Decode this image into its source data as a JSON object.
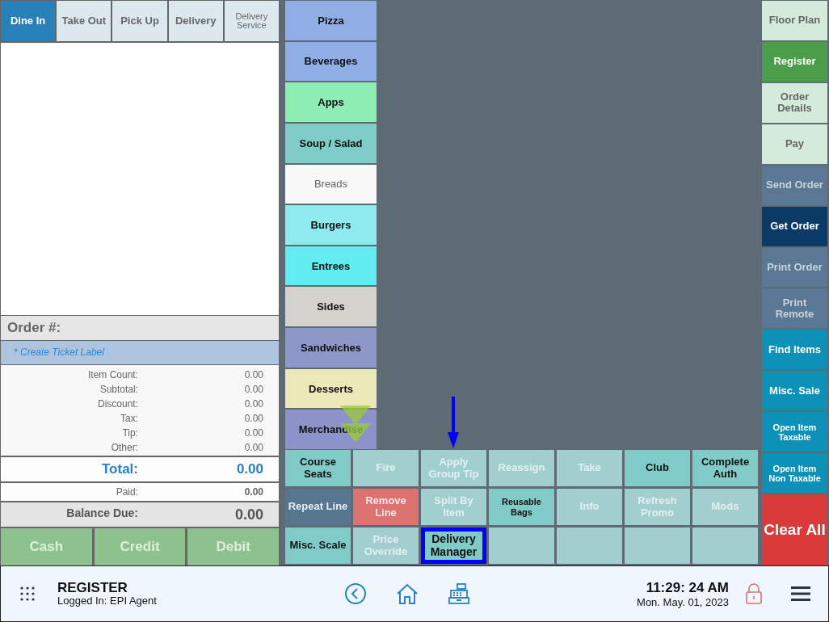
{
  "order_types": [
    {
      "label": "Dine In",
      "selected": true
    },
    {
      "label": "Take Out",
      "selected": false
    },
    {
      "label": "Pick Up",
      "selected": false
    },
    {
      "label": "Delivery",
      "selected": false
    },
    {
      "label": "Delivery Service",
      "selected": false
    }
  ],
  "order": {
    "title": "Order #:",
    "ticket_label": "* Create Ticket Label",
    "summary": [
      {
        "label": "Item Count:",
        "value": "0.00"
      },
      {
        "label": "Subtotal:",
        "value": "0.00"
      },
      {
        "label": "Discount:",
        "value": "0.00"
      },
      {
        "label": "Tax:",
        "value": "0.00"
      },
      {
        "label": "Tip:",
        "value": "0.00"
      },
      {
        "label": "Other:",
        "value": "0.00"
      }
    ],
    "total": {
      "label": "Total:",
      "value": "0.00"
    },
    "paid": {
      "label": "Paid:",
      "value": "0.00"
    },
    "balance_due": {
      "label": "Balance Due:",
      "value": "0.00"
    }
  },
  "payment_buttons": [
    {
      "label": "Cash",
      "disabled": true
    },
    {
      "label": "Credit",
      "disabled": true
    },
    {
      "label": "Debit",
      "disabled": true
    }
  ],
  "categories": [
    {
      "label": "Pizza",
      "color": "#8faee6"
    },
    {
      "label": "Beverages",
      "color": "#8faee6"
    },
    {
      "label": "Apps",
      "color": "#8eedb2"
    },
    {
      "label": "Soup / Salad",
      "color": "#7fcdc9"
    },
    {
      "label": "Breads",
      "color": "#f8f8f8"
    },
    {
      "label": "Burgers",
      "color": "#8debf0"
    },
    {
      "label": "Entrees",
      "color": "#60ecf0"
    },
    {
      "label": "Sides",
      "color": "#d4d2cc"
    },
    {
      "label": "Sandwiches",
      "color": "#8d97c8"
    },
    {
      "label": "Desserts",
      "color": "#ede8b8"
    },
    {
      "label": "Merchandise",
      "color": "#8d93c8"
    }
  ],
  "actions": [
    {
      "label": "Course Seats",
      "kind": "enabled",
      "highlighted": false
    },
    {
      "label": "Fire",
      "kind": "disabled",
      "highlighted": false
    },
    {
      "label": "Apply Group Tip",
      "kind": "disabled",
      "highlighted": false
    },
    {
      "label": "Reassign",
      "kind": "disabled",
      "highlighted": false
    },
    {
      "label": "Take",
      "kind": "disabled",
      "highlighted": false
    },
    {
      "label": "Club",
      "kind": "enabled",
      "highlighted": false
    },
    {
      "label": "Complete Auth",
      "kind": "enabled",
      "highlighted": false
    },
    {
      "label": "Repeat Line",
      "kind": "dark",
      "highlighted": false
    },
    {
      "label": "Remove Line",
      "kind": "danger",
      "highlighted": false
    },
    {
      "label": "Split By Item",
      "kind": "disabled",
      "highlighted": false
    },
    {
      "label": "Reusable Bags",
      "kind": "small",
      "highlighted": false
    },
    {
      "label": "Info",
      "kind": "disabled",
      "highlighted": false
    },
    {
      "label": "Refresh Promo",
      "kind": "disabled",
      "highlighted": false
    },
    {
      "label": "Mods",
      "kind": "disabled",
      "highlighted": false
    },
    {
      "label": "Misc. Scale",
      "kind": "enabled",
      "highlighted": false
    },
    {
      "label": "Price Override",
      "kind": "disabled",
      "highlighted": false
    },
    {
      "label": "Delivery Manager",
      "kind": "enabled",
      "highlighted": true
    },
    {
      "kind": "empty",
      "highlighted": false
    },
    {
      "kind": "empty",
      "highlighted": false
    },
    {
      "kind": "empty",
      "highlighted": false
    },
    {
      "kind": "empty",
      "highlighted": false
    }
  ],
  "side_buttons": [
    {
      "label": "Floor Plan",
      "kind": "light"
    },
    {
      "label": "Register",
      "kind": "active"
    },
    {
      "label": "Order Details",
      "kind": "light"
    },
    {
      "label": "Pay",
      "kind": "light"
    },
    {
      "label": "Send Order",
      "kind": "slate"
    },
    {
      "label": "Get Order",
      "kind": "navy"
    },
    {
      "label": "Print Order",
      "kind": "slate"
    },
    {
      "label": "Print Remote",
      "kind": "slate"
    },
    {
      "label": "Find Items",
      "kind": "teal"
    },
    {
      "label": "Misc. Sale",
      "kind": "teal"
    },
    {
      "label": "Open Item Taxable",
      "kind": "teal-small"
    },
    {
      "label": "Open Item Non Taxable",
      "kind": "teal-small"
    },
    {
      "label": "Clear All",
      "kind": "danger"
    }
  ],
  "status_bar": {
    "screen": "REGISTER",
    "user": "Logged In:  EPI Agent",
    "time": "11:29: 24 AM",
    "date": "Mon. May. 01, 2023"
  }
}
